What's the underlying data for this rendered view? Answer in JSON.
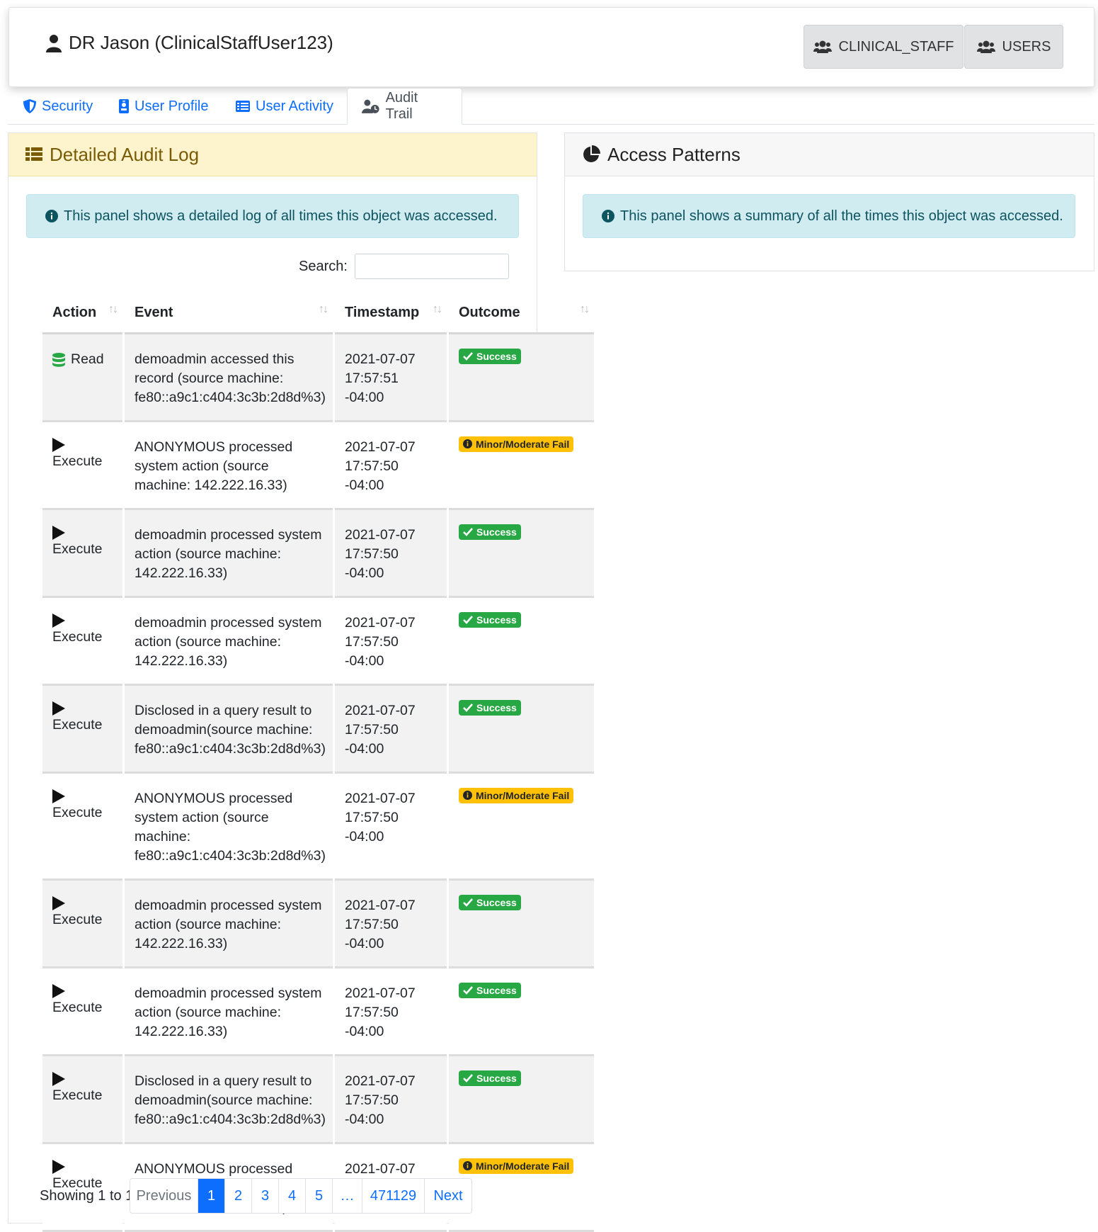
{
  "header": {
    "user_title": "DR Jason (ClinicalStaffUser123)",
    "buttons": [
      {
        "label": "CLINICAL_STAFF",
        "icon": "users-icon"
      },
      {
        "label": "USERS",
        "icon": "users-icon"
      }
    ]
  },
  "tabs": [
    {
      "label": "Security",
      "icon": "shield-icon",
      "active": false
    },
    {
      "label": "User Profile",
      "icon": "id-badge-icon",
      "active": false
    },
    {
      "label": "User Activity",
      "icon": "list-icon",
      "active": false
    },
    {
      "label": "Audit Trail",
      "icon": "user-clock-icon",
      "active": true
    }
  ],
  "audit_panel": {
    "title": "Detailed Audit Log",
    "info": "This panel shows a detailed log of all times this object was accessed.",
    "search_label": "Search:",
    "search_value": "",
    "columns": [
      "Action",
      "Event",
      "Timestamp",
      "Outcome"
    ],
    "rows": [
      {
        "action": "Read",
        "action_icon": "database-icon",
        "event": "demoadmin accessed this record (source machine: fe80::a9c1:c404:3c3b:2d8d%3)",
        "timestamp": "2021-07-07 17:57:51 -04:00",
        "outcome": "Success",
        "outcome_type": "success"
      },
      {
        "action": "Execute",
        "action_icon": "play-icon",
        "event": "ANONYMOUS processed system action (source machine: 142.222.16.33)",
        "timestamp": "2021-07-07 17:57:50 -04:00",
        "outcome": "Minor/Moderate Fail",
        "outcome_type": "fail"
      },
      {
        "action": "Execute",
        "action_icon": "play-icon",
        "event": "demoadmin processed system action (source machine: 142.222.16.33)",
        "timestamp": "2021-07-07 17:57:50 -04:00",
        "outcome": "Success",
        "outcome_type": "success"
      },
      {
        "action": "Execute",
        "action_icon": "play-icon",
        "event": "demoadmin processed system action (source machine: 142.222.16.33)",
        "timestamp": "2021-07-07 17:57:50 -04:00",
        "outcome": "Success",
        "outcome_type": "success"
      },
      {
        "action": "Execute",
        "action_icon": "play-icon",
        "event": "Disclosed in a query result to demoadmin(source machine: fe80::a9c1:c404:3c3b:2d8d%3)",
        "timestamp": "2021-07-07 17:57:50 -04:00",
        "outcome": "Success",
        "outcome_type": "success"
      },
      {
        "action": "Execute",
        "action_icon": "play-icon",
        "event": "ANONYMOUS processed system action (source machine: fe80::a9c1:c404:3c3b:2d8d%3)",
        "timestamp": "2021-07-07 17:57:50 -04:00",
        "outcome": "Minor/Moderate Fail",
        "outcome_type": "fail"
      },
      {
        "action": "Execute",
        "action_icon": "play-icon",
        "event": "demoadmin processed system action (source machine: 142.222.16.33)",
        "timestamp": "2021-07-07 17:57:50 -04:00",
        "outcome": "Success",
        "outcome_type": "success"
      },
      {
        "action": "Execute",
        "action_icon": "play-icon",
        "event": "demoadmin processed system action (source machine: 142.222.16.33)",
        "timestamp": "2021-07-07 17:57:50 -04:00",
        "outcome": "Success",
        "outcome_type": "success"
      },
      {
        "action": "Execute",
        "action_icon": "play-icon",
        "event": "Disclosed in a query result to demoadmin(source machine: fe80::a9c1:c404:3c3b:2d8d%3)",
        "timestamp": "2021-07-07 17:57:50 -04:00",
        "outcome": "Success",
        "outcome_type": "success"
      },
      {
        "action": "Execute",
        "action_icon": "play-icon",
        "event": "ANONYMOUS processed system action (source machine: 142.222.16.33)",
        "timestamp": "2021-07-07 17:57:50 -04:00",
        "outcome": "Minor/Moderate Fail",
        "outcome_type": "fail"
      }
    ],
    "showing_text": "Showing 1 to 1",
    "pagination": [
      "Previous",
      "1",
      "2",
      "3",
      "4",
      "5",
      "…",
      "471129",
      "Next"
    ],
    "current_page": "1"
  },
  "patterns_panel": {
    "title": "Access Patterns",
    "info": "This panel shows a summary of all the times this object was accessed."
  },
  "colors": {
    "accent": "#0d6efd",
    "success": "#28a745",
    "warning": "#ffc107",
    "audit_header_bg": "#fdf3cd",
    "info_bg": "#d1ecf1"
  }
}
